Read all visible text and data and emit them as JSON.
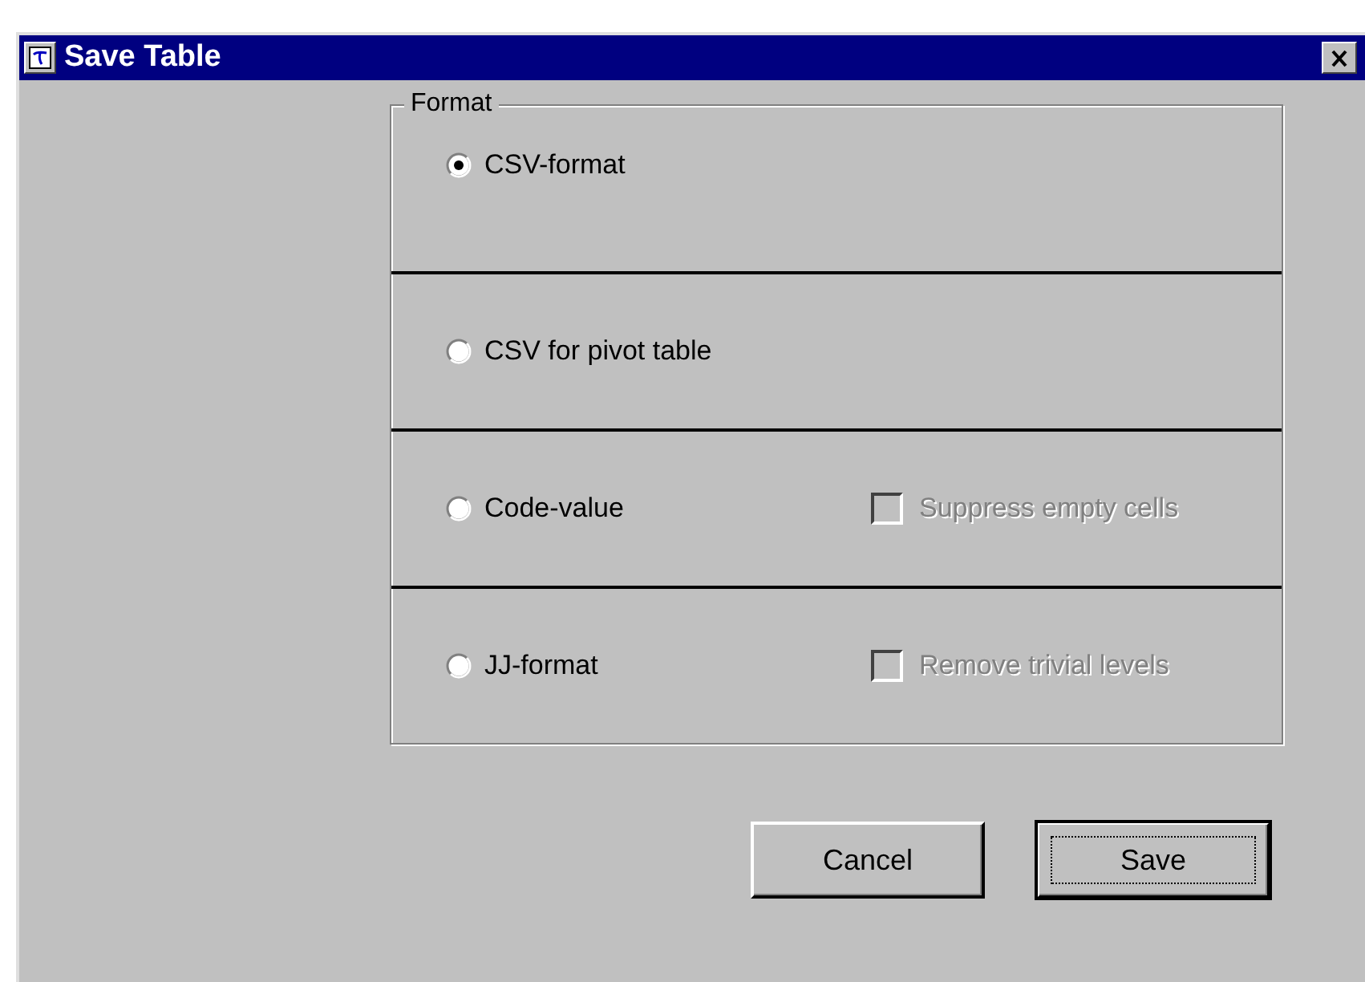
{
  "window": {
    "title": "Save Table"
  },
  "format_group": {
    "label": "Format",
    "options": [
      {
        "label": "CSV-format",
        "selected": true
      },
      {
        "label": "CSV for pivot table",
        "selected": false
      },
      {
        "label": "Code-value",
        "selected": false,
        "checkbox": {
          "label": "Suppress empty cells",
          "checked": false,
          "disabled": true
        }
      },
      {
        "label": "JJ-format",
        "selected": false,
        "checkbox": {
          "label": "Remove trivial levels",
          "checked": false,
          "disabled": true
        }
      }
    ]
  },
  "buttons": [
    {
      "label": "Cancel",
      "default": false
    },
    {
      "label": "Save",
      "default": true
    }
  ]
}
